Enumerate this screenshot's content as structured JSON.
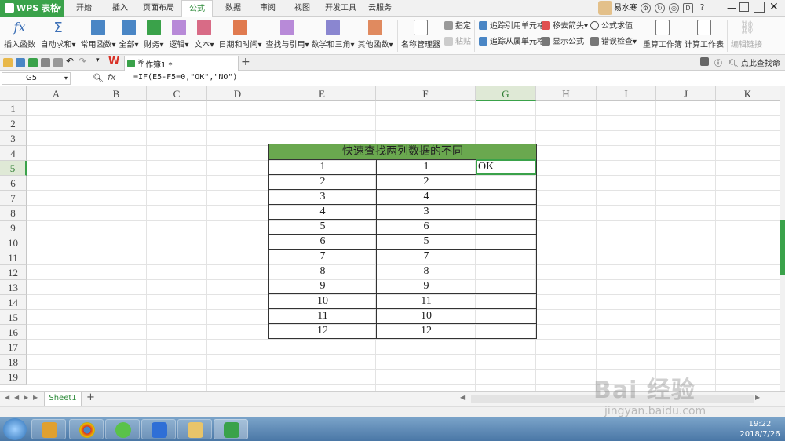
{
  "menubar": {
    "brand": "WPS 表格",
    "tabs": [
      "开始",
      "插入",
      "页面布局",
      "公式",
      "数据",
      "审阅",
      "视图",
      "开发工具",
      "云服务"
    ],
    "active_tab": "公式",
    "user_name": "易水寒"
  },
  "ribbon": {
    "insert_function": "插入函数",
    "autosum": "自动求和",
    "common": "常用函数",
    "all": "全部",
    "finance": "财务",
    "logic": "逻辑",
    "text": "文本",
    "datetime": "日期和时间",
    "lookup": "查找与引用",
    "math": "数学和三角",
    "other": "其他函数",
    "name_manager": "名称管理器",
    "specify": "指定",
    "paste": "粘贴",
    "trace_precedents": "追踪引用单元格",
    "trace_dependents": "追踪从属单元格",
    "remove_arrows": "移去箭头",
    "show_formulas": "显示公式",
    "eval_formula": "公式求值",
    "error_check": "错误检查",
    "recalc_workbook": "重算工作簿",
    "calc_sheet": "计算工作表",
    "edit_links": "编辑链接"
  },
  "docbar": {
    "doc_tab": "工作簿1 *",
    "find": "点此查找命令"
  },
  "formula_bar": {
    "name_box": "G5",
    "fx": "fx",
    "formula": "=IF(E5-F5=0,\"OK\",\"NO\")"
  },
  "grid": {
    "columns": [
      "A",
      "B",
      "C",
      "D",
      "E",
      "F",
      "G",
      "H",
      "I",
      "J",
      "K"
    ],
    "rows": [
      "1",
      "2",
      "3",
      "4",
      "5",
      "6",
      "7",
      "8",
      "9",
      "10",
      "11",
      "12",
      "13",
      "14",
      "15",
      "16",
      "17",
      "18",
      "19"
    ],
    "selected_col": "G",
    "selected_row": "5"
  },
  "table": {
    "title": "快速查找两列数据的不同",
    "rows": [
      [
        "1",
        "1",
        "OK"
      ],
      [
        "2",
        "2",
        ""
      ],
      [
        "3",
        "4",
        ""
      ],
      [
        "4",
        "3",
        ""
      ],
      [
        "5",
        "6",
        ""
      ],
      [
        "6",
        "5",
        ""
      ],
      [
        "7",
        "7",
        ""
      ],
      [
        "8",
        "8",
        ""
      ],
      [
        "9",
        "9",
        ""
      ],
      [
        "10",
        "11",
        ""
      ],
      [
        "11",
        "10",
        ""
      ],
      [
        "12",
        "12",
        ""
      ]
    ]
  },
  "sheets": {
    "active": "Sheet1"
  },
  "taskbar": {
    "time": "19:22",
    "date": "2018/7/26"
  },
  "watermark": {
    "text": "Bai 经验",
    "sub": "jingyan.baidu.com"
  },
  "colors": {
    "accent": "#3aa24a",
    "title_fill": "#6aa84f"
  }
}
